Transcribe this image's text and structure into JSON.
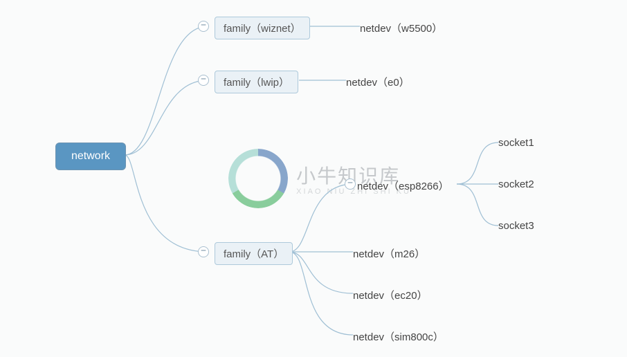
{
  "root": {
    "label": "network"
  },
  "families": [
    {
      "label": "family（wiznet）",
      "devices": [
        {
          "label": "netdev（w5500）",
          "sockets": []
        }
      ]
    },
    {
      "label": "family（lwip）",
      "devices": [
        {
          "label": "netdev（e0）",
          "sockets": []
        }
      ]
    },
    {
      "label": "family（AT）",
      "devices": [
        {
          "label": "netdev（esp8266）",
          "sockets": [
            "socket1",
            "socket2",
            "socket3"
          ]
        },
        {
          "label": "netdev（m26）",
          "sockets": []
        },
        {
          "label": "netdev（ec20）",
          "sockets": []
        },
        {
          "label": "netdev（sim800c）",
          "sockets": []
        }
      ]
    }
  ],
  "watermark": {
    "cn": "小牛知识库",
    "en": "XIAO NIU ZHI SHI KU"
  }
}
